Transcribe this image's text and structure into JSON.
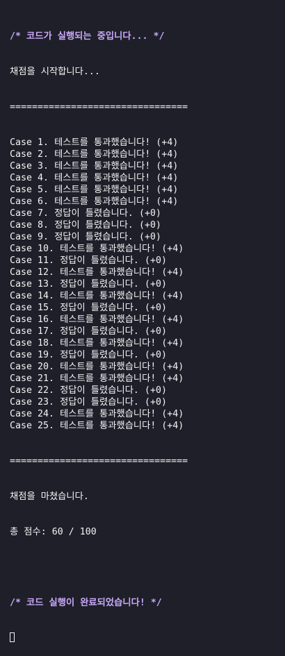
{
  "terminal": {
    "running_comment": "/* 코드가 실행되는 중입니다... */",
    "start_message": "채점을 시작합니다...",
    "separator": "================================",
    "cases": [
      {
        "label": "Case 1.",
        "result": "테스트를 통과했습니다! (+4)"
      },
      {
        "label": "Case 2.",
        "result": "테스트를 통과했습니다! (+4)"
      },
      {
        "label": "Case 3.",
        "result": "테스트를 통과했습니다! (+4)"
      },
      {
        "label": "Case 4.",
        "result": "테스트를 통과했습니다! (+4)"
      },
      {
        "label": "Case 5.",
        "result": "테스트를 통과했습니다! (+4)"
      },
      {
        "label": "Case 6.",
        "result": "테스트를 통과했습니다! (+4)"
      },
      {
        "label": "Case 7.",
        "result": "정답이 틀렸습니다. (+0)"
      },
      {
        "label": "Case 8.",
        "result": "정답이 틀렸습니다. (+0)"
      },
      {
        "label": "Case 9.",
        "result": "정답이 틀렸습니다. (+0)"
      },
      {
        "label": "Case 10.",
        "result": "테스트를 통과했습니다! (+4)"
      },
      {
        "label": "Case 11.",
        "result": "정답이 틀렸습니다. (+0)"
      },
      {
        "label": "Case 12.",
        "result": "테스트를 통과했습니다! (+4)"
      },
      {
        "label": "Case 13.",
        "result": "정답이 틀렸습니다. (+0)"
      },
      {
        "label": "Case 14.",
        "result": "테스트를 통과했습니다! (+4)"
      },
      {
        "label": "Case 15.",
        "result": "정답이 틀렸습니다. (+0)"
      },
      {
        "label": "Case 16.",
        "result": "테스트를 통과했습니다! (+4)"
      },
      {
        "label": "Case 17.",
        "result": "정답이 틀렸습니다. (+0)"
      },
      {
        "label": "Case 18.",
        "result": "테스트를 통과했습니다! (+4)"
      },
      {
        "label": "Case 19.",
        "result": "정답이 틀렸습니다. (+0)"
      },
      {
        "label": "Case 20.",
        "result": "테스트를 통과했습니다! (+4)"
      },
      {
        "label": "Case 21.",
        "result": "테스트를 통과했습니다! (+4)"
      },
      {
        "label": "Case 22.",
        "result": "정답이 틀렸습니다. (+0)"
      },
      {
        "label": "Case 23.",
        "result": "정답이 틀렸습니다. (+0)"
      },
      {
        "label": "Case 24.",
        "result": "테스트를 통과했습니다! (+4)"
      },
      {
        "label": "Case 25.",
        "result": "테스트를 통과했습니다! (+4)"
      }
    ],
    "end_message": "채점을 마쳤습니다.",
    "score": "총 점수: 60 / 100",
    "done_comment": "/* 코드 실행이 완료되었습니다! */"
  },
  "colors": {
    "background": "#1e1f29",
    "text": "#f4f4f4",
    "comment": "#c9a8f8"
  }
}
